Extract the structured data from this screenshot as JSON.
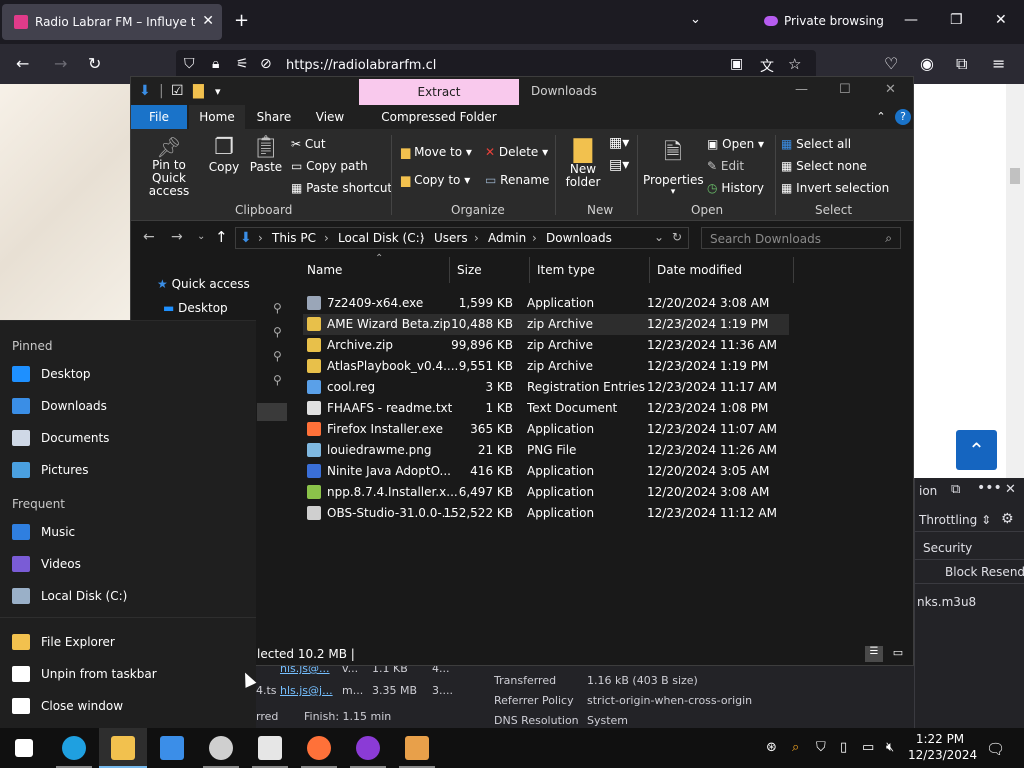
{
  "browser": {
    "tab_title": "Radio Labrar FM – Influye tus se",
    "new_tab": "+",
    "list_all_tabs": "⌄",
    "private_label": "Private browsing",
    "url": "https://radiolabrarfm.cl"
  },
  "devtools": {
    "side_label": "ion",
    "throttling": "Throttling ⇕",
    "security": "Security",
    "block": "Block",
    "resend": "Resend",
    "file": "nks.m3u8",
    "rows": [
      {
        "a": "hls.js@...",
        "b": "v...",
        "c": "1.1 KB",
        "d": "4..."
      },
      {
        "a": "hls.js@j...",
        "b": "m...",
        "c": "3.35 MB",
        "d": "3...."
      }
    ],
    "ts_prefix": "4.ts",
    "transferred_label": "Transferred",
    "transferred_value": "1.16 kB (403 B size)",
    "referrer_label": "Referrer Policy",
    "referrer_value": "strict-origin-when-cross-origin",
    "dns_label": "DNS Resolution",
    "dns_value": "System",
    "footer_left": "rred",
    "footer_finish": "Finish: 1.15 min"
  },
  "explorer": {
    "contextual_tab": "Extract",
    "window_title": "Downloads",
    "tabs": [
      "File",
      "Home",
      "Share",
      "View",
      "Compressed Folder Tools"
    ],
    "ribbon": {
      "pin": "Pin to Quick access",
      "copy": "Copy",
      "paste": "Paste",
      "cut": "Cut",
      "copy_path": "Copy path",
      "paste_shortcut": "Paste shortcut",
      "clipboard": "Clipboard",
      "move_to": "Move to",
      "copy_to": "Copy to",
      "delete": "Delete",
      "rename": "Rename",
      "organize": "Organize",
      "new_folder": "New folder",
      "new": "New",
      "properties": "Properties",
      "open": "Open",
      "edit": "Edit",
      "history": "History",
      "open_group": "Open",
      "select_all": "Select all",
      "select_none": "Select none",
      "invert_selection": "Invert selection",
      "select_group": "Select"
    },
    "path": [
      "This PC",
      "Local Disk (C:)",
      "Users",
      "Admin",
      "Downloads"
    ],
    "search_placeholder": "Search Downloads",
    "nav": {
      "quick_access": "Quick access",
      "desktop": "Desktop"
    },
    "columns": [
      "Name",
      "Size",
      "Item type",
      "Date modified"
    ],
    "files": [
      {
        "name": "7z2409-x64.exe",
        "size": "1,599 KB",
        "type": "Application",
        "date": "12/20/2024 3:08 AM",
        "icon": "exe-icon",
        "color": "#9aa6b8"
      },
      {
        "name": "AME Wizard Beta.zip",
        "size": "10,488 KB",
        "type": "zip Archive",
        "date": "12/23/2024 1:19 PM",
        "icon": "zip-icon",
        "color": "#e8c04a"
      },
      {
        "name": "Archive.zip",
        "size": "99,896 KB",
        "type": "zip Archive",
        "date": "12/23/2024 11:36 AM",
        "icon": "zip-icon",
        "color": "#e8c04a"
      },
      {
        "name": "AtlasPlaybook_v0.4....",
        "size": "9,551 KB",
        "type": "zip Archive",
        "date": "12/23/2024 1:19 PM",
        "icon": "zip-icon",
        "color": "#e8c04a"
      },
      {
        "name": "cool.reg",
        "size": "3 KB",
        "type": "Registration Entries",
        "date": "12/23/2024 11:17 AM",
        "icon": "reg-icon",
        "color": "#5aa0e8"
      },
      {
        "name": "FHAAFS - readme.txt",
        "size": "1 KB",
        "type": "Text Document",
        "date": "12/23/2024 1:08 PM",
        "icon": "text-file-icon",
        "color": "#e0e0e0"
      },
      {
        "name": "Firefox Installer.exe",
        "size": "365 KB",
        "type": "Application",
        "date": "12/23/2024 11:07 AM",
        "icon": "firefox-icon",
        "color": "#ff7139"
      },
      {
        "name": "louiedrawme.png",
        "size": "21 KB",
        "type": "PNG File",
        "date": "12/23/2024 11:26 AM",
        "icon": "image-file-icon",
        "color": "#7fb8e0"
      },
      {
        "name": "Ninite Java AdoptO...",
        "size": "416 KB",
        "type": "Application",
        "date": "12/20/2024 3:05 AM",
        "icon": "ninite-icon",
        "color": "#3a6fd8"
      },
      {
        "name": "npp.8.7.4.Installer.x...",
        "size": "6,497 KB",
        "type": "Application",
        "date": "12/20/2024 3:08 AM",
        "icon": "notepadpp-icon",
        "color": "#8bc34a"
      },
      {
        "name": "OBS-Studio-31.0.0-...",
        "size": "152,522 KB",
        "type": "Application",
        "date": "12/23/2024 11:12 AM",
        "icon": "obs-icon",
        "color": "#cfcfcf"
      }
    ],
    "status": "lected  10.2 MB  |"
  },
  "jumplist": {
    "pinned_header": "Pinned",
    "pinned": [
      {
        "label": "Desktop",
        "icon": "desktop-icon",
        "color": "#1e90ff"
      },
      {
        "label": "Downloads",
        "icon": "downloads-icon",
        "color": "#3a8ee6"
      },
      {
        "label": "Documents",
        "icon": "documents-icon",
        "color": "#cfd8e6"
      },
      {
        "label": "Pictures",
        "icon": "pictures-icon",
        "color": "#4aa0e0"
      }
    ],
    "frequent_header": "Frequent",
    "frequent": [
      {
        "label": "Music",
        "icon": "music-icon",
        "color": "#2f7fe0"
      },
      {
        "label": "Videos",
        "icon": "videos-icon",
        "color": "#7a5cd6"
      },
      {
        "label": "Local Disk (C:)",
        "icon": "drive-icon",
        "color": "#9ab0c8"
      }
    ],
    "tasks": [
      {
        "label": "File Explorer",
        "icon": "file-explorer-icon",
        "color": "#f2c14e"
      },
      {
        "label": "Unpin from taskbar",
        "icon": "unpin-icon",
        "color": "#ffffff"
      },
      {
        "label": "Close window",
        "icon": "close-icon",
        "color": "#ffffff"
      }
    ]
  },
  "taskbar": {
    "time": "1:22 PM",
    "date": "12/23/2024",
    "apps": [
      {
        "name": "start-button",
        "color": "#ffffff"
      },
      {
        "name": "edge-icon",
        "color": "#1fa0e0"
      },
      {
        "name": "file-explorer-icon",
        "color": "#f2c14e"
      },
      {
        "name": "store-icon",
        "color": "#3b8ee8"
      },
      {
        "name": "obs-icon",
        "color": "#cfcfcf"
      },
      {
        "name": "7zip-icon",
        "color": "#e6e6e6"
      },
      {
        "name": "firefox-icon",
        "color": "#ff7139"
      },
      {
        "name": "firefox-private-icon",
        "color": "#8b3bd6"
      },
      {
        "name": "virtualbox-icon",
        "color": "#e8a04a"
      }
    ]
  }
}
